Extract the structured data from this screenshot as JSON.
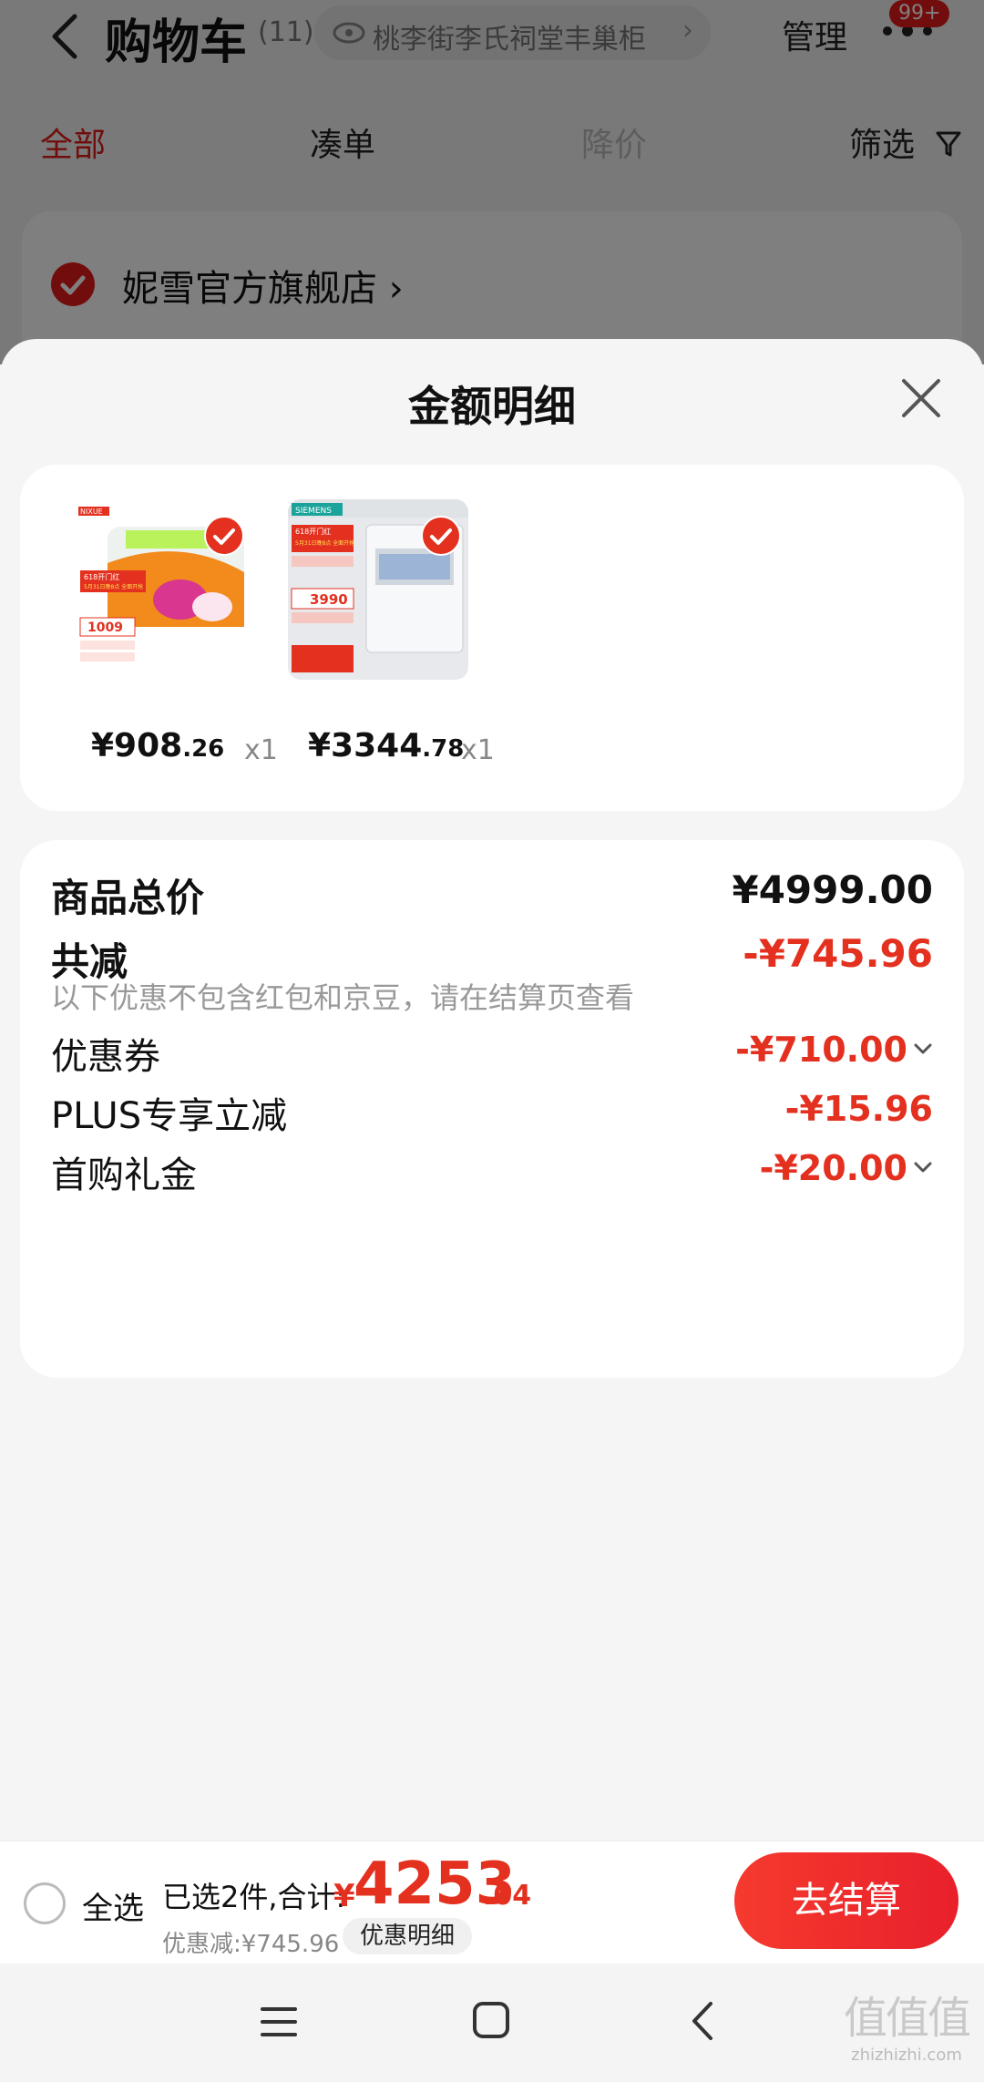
{
  "header": {
    "title": "购物车",
    "count": "(11)",
    "address": "桃李街李氏祠堂丰巢柜",
    "manage": "管理",
    "badge": "99+"
  },
  "tabs": [
    {
      "label": "全部"
    },
    {
      "label": "凑单"
    },
    {
      "label": "降价"
    },
    {
      "label": "筛选"
    }
  ],
  "store": {
    "name": "妮雪官方旗舰店"
  },
  "sheet": {
    "title": "金额明细",
    "products": [
      {
        "price_int": "¥908",
        "price_dec": ".26",
        "qty": "x1",
        "image": {
          "brand": "NIXUE",
          "promo": "618开门红",
          "tag": "5月31日晚8点 全面开抢",
          "price": "1009"
        }
      },
      {
        "price_int": "¥3344",
        "price_dec": ".78",
        "qty": "x1",
        "image": {
          "brand": "SIEMENS",
          "promo": "618开门红",
          "tag": "5月31日晚8点 全面开抢",
          "price": "3990"
        }
      }
    ],
    "summary": {
      "total_label": "商品总价",
      "total_value": "¥4999.00",
      "discount_label": "共减",
      "discount_value": "-¥745.96",
      "discount_note": "以下优惠不包含红包和京豆，请在结算页查看",
      "items": [
        {
          "label": "优惠券",
          "value": "-¥710.00"
        },
        {
          "label": "PLUS专享立减",
          "value": "-¥15.96"
        },
        {
          "label": "首购礼金",
          "value": "-¥20.00"
        }
      ]
    }
  },
  "checkout": {
    "select_all": "全选",
    "selected_info": "已选2件,合计:",
    "total_yen": "¥",
    "total_int": "4253",
    "total_dec": ".04",
    "discount_info": "优惠减:¥745.96",
    "detail_label": "优惠明细",
    "button_label": "去结算"
  },
  "watermark": {
    "glyphs": "值值值",
    "url": "zhizhizhi.com"
  },
  "colors": {
    "accent": "#e3301f",
    "checkout_button": "#f02f2f"
  }
}
